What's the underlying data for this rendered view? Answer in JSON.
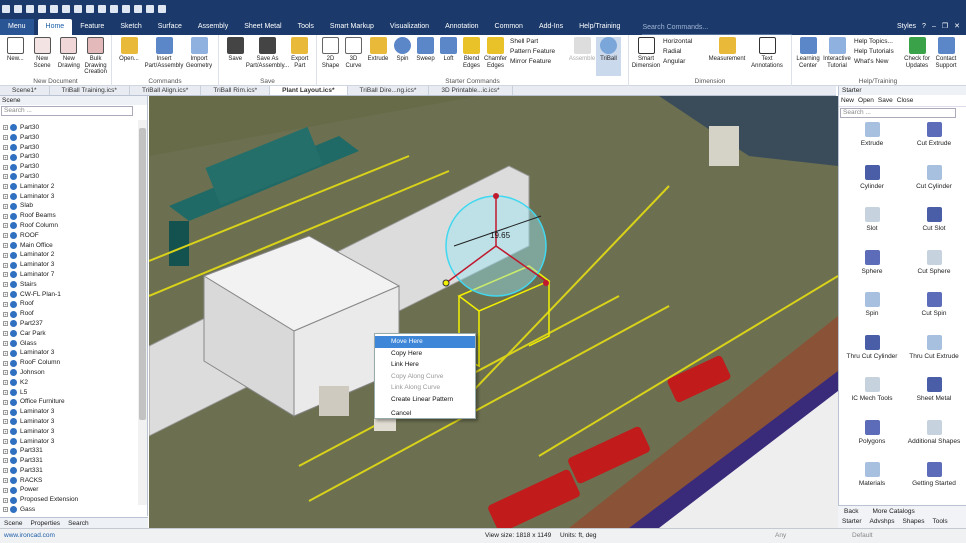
{
  "app": {
    "accent": "#1b3a6b",
    "ribbon_accent": "#1b5ea8"
  },
  "menu_button": "Menu",
  "ribbon_tabs": [
    "Home",
    "Feature",
    "Sketch",
    "Surface",
    "Assembly",
    "Sheet Metal",
    "Tools",
    "Smart Markup",
    "Visualization",
    "Annotation",
    "Common",
    "Add-Ins",
    "Help/Training"
  ],
  "search_commands": "Search Commands...",
  "window_controls": {
    "styles": "Styles",
    "help": "?"
  },
  "ribbon": {
    "new_document": {
      "label": "New Document",
      "new": "New...",
      "new_scene": "New Scene",
      "new_drawing": "New Drawing",
      "bulk_drawing": "Bulk Drawing Creation"
    },
    "commands": {
      "label": "Commands",
      "open": "Open...",
      "insert": "Insert Part/Assembly",
      "import": "Import Geometry"
    },
    "save": {
      "label": "Save",
      "save": "Save",
      "save_as": "Save As Part/Assembly...",
      "export": "Export Part"
    },
    "starter": {
      "label": "Starter Commands",
      "shape2d": "2D Shape",
      "curve3d": "3D Curve",
      "extrude": "Extrude",
      "spin": "Spin",
      "sweep": "Sweep",
      "loft": "Loft",
      "blend": "Blend Edges",
      "chamfer": "Chamfer Edges",
      "shell": "Shell Part",
      "pattern": "Pattern Feature",
      "mirror": "Mirror Feature",
      "assemble": "Assemble",
      "triball": "TriBall"
    },
    "dimension": {
      "label": "Dimension",
      "smart": "Smart Dimension",
      "horizontal": "Horizontal",
      "radial": "Radial",
      "angular": "Angular",
      "measurement": "Measurement",
      "text": "Text Annotations"
    },
    "help": {
      "label": "Help/Training",
      "learning": "Learning Center",
      "interactive": "Interactive Tutorial",
      "help_topics": "Help Topics...",
      "help_tutorials": "Help Tutorials",
      "whats_new": "What's New",
      "check_updates": "Check for Updates",
      "contact": "Contact Support"
    }
  },
  "doc_tabs": [
    "Scene1*",
    "TriBall Training.ics*",
    "TriBall Align.ics*",
    "TriBall Rim.ics*",
    "Plant Layout.ics*",
    "TriBall Dire...ng.ics*",
    "3D Printable...ic.ics*"
  ],
  "scene_panel": {
    "title": "Scene",
    "search_placeholder": "Search ...",
    "items": [
      "Part30",
      "Part30",
      "Part30",
      "Part30",
      "Part30",
      "Part30",
      "Laminator 2",
      "Laminator 3",
      "Slab",
      "Roof Beams",
      "Roof Column",
      "ROOF",
      "Main Office",
      "Laminator 2",
      "Laminator 3",
      "Laminator 7",
      "Stairs",
      "CW-FL Plan-1",
      "Roof",
      "Roof",
      "Part237",
      "Car Park",
      "Glass",
      "Laminator 3",
      "RooF Column",
      "Johnson",
      "K2",
      "L5",
      "Office Furniture",
      "Laminator 3",
      "Laminator 3",
      "Laminator 3",
      "Laminator 3",
      "Part331",
      "Part331",
      "Part331",
      "RACKS",
      "Power",
      "Proposed Extension",
      "Gass"
    ],
    "bottom_tabs": [
      "Scene",
      "Properties",
      "Search"
    ]
  },
  "viewport": {
    "dimension_label": "19.65"
  },
  "context_menu": [
    "Move Here",
    "Copy Here",
    "Link Here",
    "Copy Along Curve",
    "Link Along Curve",
    "Create Linear Pattern",
    "Cancel"
  ],
  "catalog": {
    "title": "Starter",
    "new": "New",
    "open": "Open",
    "save": "Save",
    "close": "Close",
    "search_placeholder": "Search ...",
    "items": [
      "Extrude",
      "Cut Extrude",
      "Cylinder",
      "Cut Cylinder",
      "Slot",
      "Cut Slot",
      "Sphere",
      "Cut Sphere",
      "Spin",
      "Cut Spin",
      "Thru Cut Cylinder",
      "Thru Cut Extrude",
      "IC Mech Tools",
      "Sheet Metal",
      "Polygons",
      "Additional Shapes",
      "Materials",
      "Getting Started"
    ],
    "back": "Back",
    "more": "More Catalogs",
    "bottom_tabs": [
      "Starter",
      "Advshps",
      "Shapes",
      "Tools"
    ]
  },
  "status": {
    "url": "www.ironcad.com",
    "view_size": "View size: 1818 x 1149",
    "units": "Units:  ft, deg",
    "any": "Any",
    "default": "Default"
  }
}
